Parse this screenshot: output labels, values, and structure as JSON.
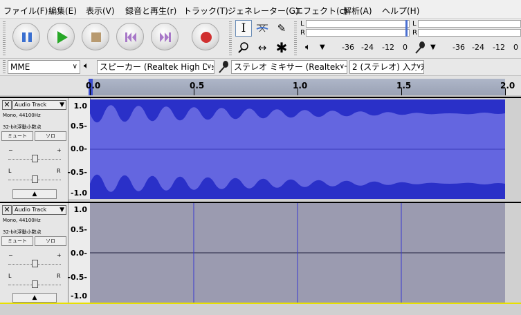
{
  "menu": [
    "ファイル(F)",
    "編集(E)",
    "表示(V)",
    "録音と再生(r)",
    "トラック(T)",
    "ジェネレーター(G)",
    "エフェクト(c)",
    "解析(A)",
    "ヘルプ(H)"
  ],
  "transport": [
    {
      "name": "pause",
      "color": "#3a6fd0"
    },
    {
      "name": "play",
      "color": "#28a828"
    },
    {
      "name": "stop",
      "color": "#b89a70"
    },
    {
      "name": "skip-start",
      "color": "#a878c8"
    },
    {
      "name": "skip-end",
      "color": "#a878c8"
    },
    {
      "name": "record",
      "color": "#d03030"
    }
  ],
  "meters": {
    "play_label_l": "L",
    "play_label_r": "R",
    "rec_label_l": "L",
    "rec_label_r": "R",
    "play_scale": [
      "-36",
      "-24",
      "-12",
      "0"
    ],
    "rec_scale": [
      "-36",
      "-24",
      "-12",
      "0"
    ]
  },
  "devices": {
    "host": "MME",
    "output": "スピーカー (Realtek High Def",
    "input": "ステレオ ミキサー (Realtek Hig",
    "channels": "2 (ステレオ) 入力チ"
  },
  "ruler": {
    "labels": [
      "0.0",
      "0.5",
      "1.0",
      "1.5",
      "2.0"
    ]
  },
  "tracks": [
    {
      "name": "Audio Track",
      "info1": "Mono, 44100Hz",
      "info2": "32-bit浮動小数点",
      "mute": "ミュート",
      "solo": "ソロ",
      "gain_minus": "−",
      "gain_plus": "+",
      "pan_l": "L",
      "pan_r": "R",
      "collapse": "▲",
      "scale": [
        "1.0",
        "0.5-",
        "0.0-",
        "-0.5-",
        "-1.0"
      ]
    },
    {
      "name": "Audio Track",
      "info1": "Mono, 44100Hz",
      "info2": "32-bit浮動小数点",
      "mute": "ミュート",
      "solo": "ソロ",
      "gain_minus": "−",
      "gain_plus": "+",
      "pan_l": "L",
      "pan_r": "R",
      "collapse": "▲",
      "scale": [
        "1.0",
        "0.5-",
        "0.0-",
        "-0.5-",
        "-1.0"
      ]
    }
  ],
  "colors": {
    "wave_fill": "#6466e0",
    "wave_edge": "#2a30c8",
    "empty_bg": "#9b9bb0",
    "selected_bg": "#9b9bb0"
  }
}
